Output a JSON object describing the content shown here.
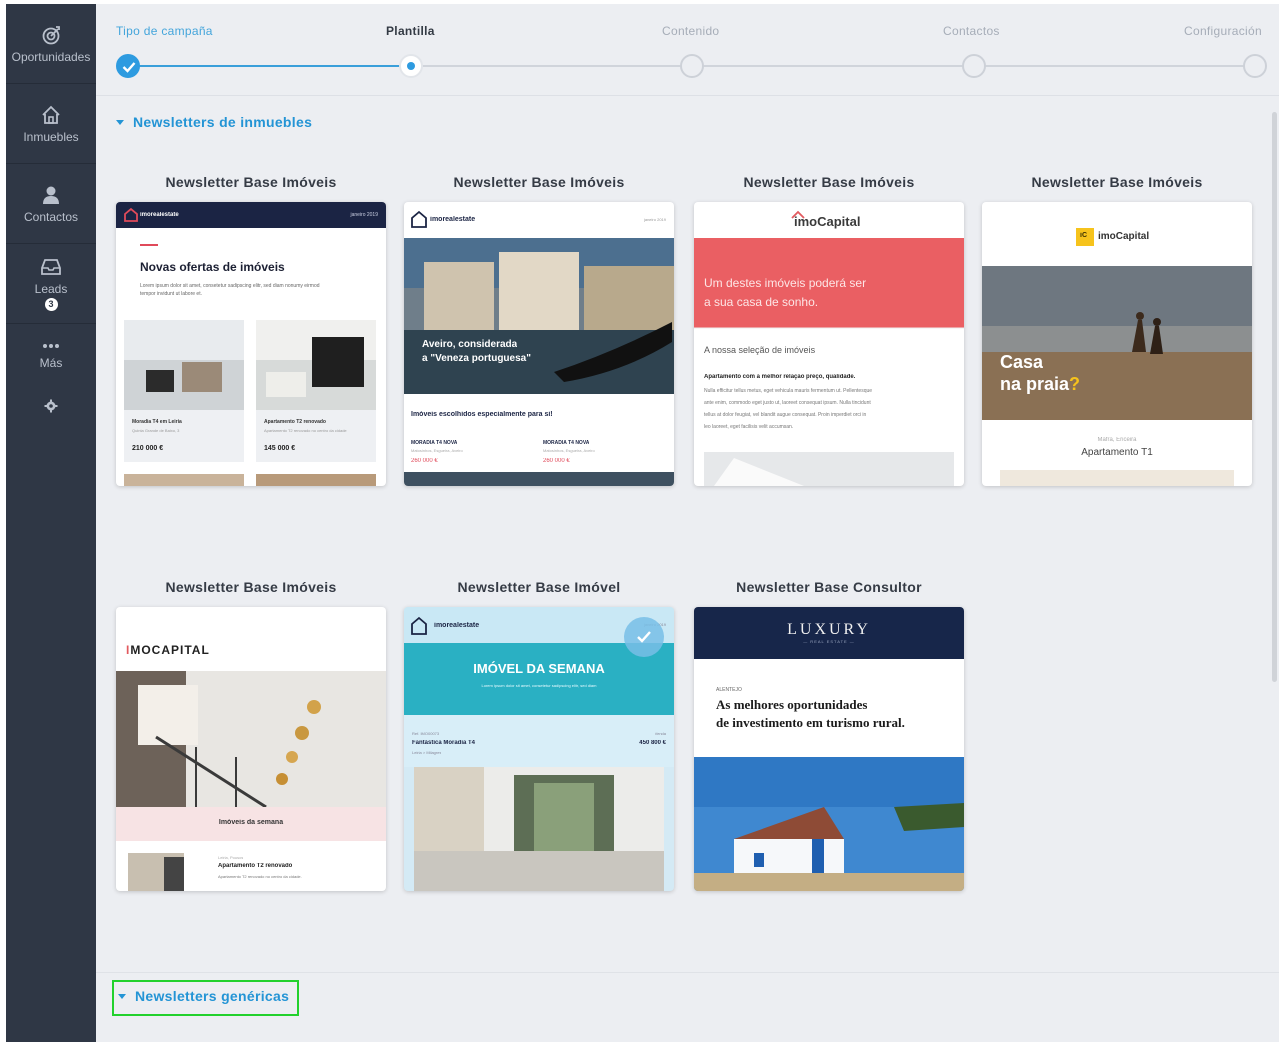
{
  "sidebar": {
    "items": [
      {
        "label": "Oportunidades",
        "icon": "target-icon"
      },
      {
        "label": "Inmuebles",
        "icon": "house-icon"
      },
      {
        "label": "Contactos",
        "icon": "person-icon"
      },
      {
        "label": "Leads",
        "icon": "inbox-icon",
        "badge": "3"
      },
      {
        "label": "Más",
        "icon": "more-dots-icon"
      }
    ],
    "settings_icon": "gear-icon"
  },
  "stepper": {
    "steps": [
      {
        "label": "Tipo de campaña",
        "state": "done"
      },
      {
        "label": "Plantilla",
        "state": "active"
      },
      {
        "label": "Contenido",
        "state": "pending"
      },
      {
        "label": "Contactos",
        "state": "pending"
      },
      {
        "label": "Configuración",
        "state": "pending"
      }
    ]
  },
  "sections": {
    "inmuebles": {
      "label": "Newsletters de inmuebles"
    },
    "genericas": {
      "label": "Newsletters genéricas"
    }
  },
  "templates": [
    {
      "title": "Newsletter Base Imóveis",
      "preview": {
        "brand": "imorealestate",
        "date": "janeiro 2019",
        "heading": "Novas ofertas de imóveis",
        "lorem": "Lorem ipsum dolor sit amet, consetetur sadipscing elitr, sed diam nonumy eirmod tempor invidunt ut labore et.",
        "prop1_name": "Moradia T4 em Leiria",
        "prop1_sub": "Quinta Grande de Baixo, 3",
        "prop1_price": "210 000 €",
        "prop2_name": "Apartamento T2 renovado",
        "prop2_sub": "Apartamento T2 renovado no centro da cidade",
        "prop2_price": "145 000 €"
      }
    },
    {
      "title": "Newsletter Base Imóveis",
      "preview": {
        "brand": "imorealestate",
        "date": "janeiro 2019",
        "hero_line1": "Aveiro, considerada",
        "hero_line2": "a \"Veneza portuguesa\"",
        "caption": "Imóveis escolhidos especialmente para si!",
        "p1_name": "MORADIA T4 NOVA",
        "p1_sub": "Matosinhos, Esgueira, Aveiro",
        "p1_price": "260 000 €",
        "p2_name": "MORADIA T4 NOVA",
        "p2_sub": "Matosinhos, Esgueira, Aveiro",
        "p2_price": "260 000 €"
      }
    },
    {
      "title": "Newsletter Base Imóveis",
      "preview": {
        "brand": "imoCapital",
        "banner_line1": "Um destes imóveis poderá ser",
        "banner_line2": "a sua casa de sonho.",
        "section": "A nossa seleção de imóveis",
        "bold": "Apartamento com a melhor relação preço, qualidade.",
        "body1": "Nulla efficitur tellus metus, eget vehicula mauris fermentum ut. Pellentesque",
        "body2": "ante enim, commodo eget justo ut, laoreet consequat ipsum. Nulla tincidunt",
        "body3": "tellus at dolor feugiat, vel blandit augue consequat. Proin imperdiet orci in",
        "body4": "leo laoreet, eget facilisis velit accumsan."
      }
    },
    {
      "title": "Newsletter Base Imóveis",
      "preview": {
        "logo_mark": "iC",
        "brand": "imoCapital",
        "hero_line1": "Casa",
        "hero_line2": "na praia",
        "hero_q": "?",
        "location": "Mafra, Ericeira",
        "name": "Apartamento T1"
      }
    },
    {
      "title": "Newsletter Base Imóveis",
      "preview": {
        "brand_first": "I",
        "brand_rest": "MOCAPITAL",
        "band": "Imóveis da semana",
        "location": "Leiria, Pousos",
        "name": "Apartamento T2 renovado",
        "desc": "Apartamento T2 renovado no centro da cidade."
      }
    },
    {
      "title": "Newsletter Base Imóvel",
      "selected": true,
      "preview": {
        "brand": "imorealestate",
        "date": "janeiro 2019",
        "heading": "IMÓVEL DA SEMANA",
        "lorem": "Lorem ipsum dolor sit amet, consetetur sadipscing elitr, sed diam",
        "ref": "Ref. IMO00073",
        "name": "Fantástica Moradia T4",
        "location": "Leiria > Milagres",
        "status": "Venda",
        "price": "450 800 €"
      }
    },
    {
      "title": "Newsletter Base Consultor",
      "preview": {
        "brand": "LUXURY",
        "brand_sub": "— REAL ESTATE —",
        "region": "ALENTEJO",
        "line1": "As melhores oportunidades",
        "line2": "de investimento em turismo rural."
      }
    }
  ],
  "colors": {
    "sidebar": "#2f3745",
    "accent": "#2394d5",
    "highlight": "#22d12d"
  }
}
